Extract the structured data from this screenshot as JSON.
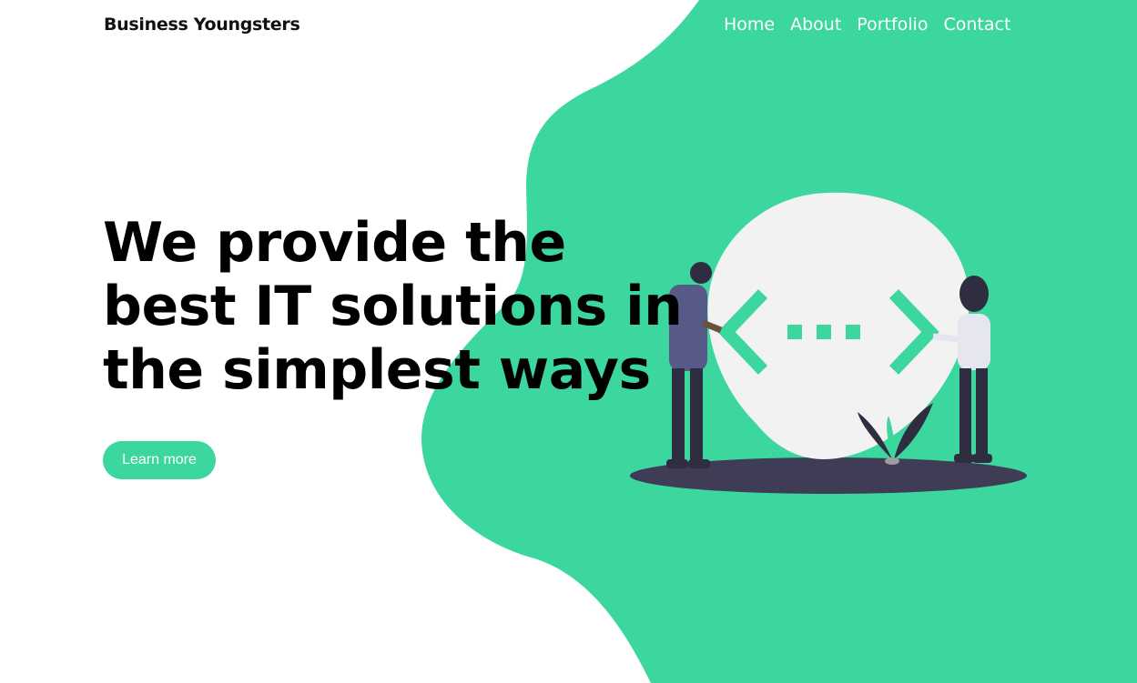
{
  "brand": {
    "name": "Business Youngsters"
  },
  "nav": {
    "items": [
      "Home",
      "About",
      "Portfolio",
      "Contact"
    ]
  },
  "hero": {
    "title": "We provide the best IT solutions in the simplest ways",
    "cta_label": "Learn more"
  },
  "colors": {
    "accent": "#3cd69f",
    "dark": "#3f3d56",
    "light_gray": "#f2f2f2",
    "text": "#000000",
    "nav_text": "#ffffff"
  },
  "illustration": {
    "name": "people-with-code-brackets-illustration"
  }
}
